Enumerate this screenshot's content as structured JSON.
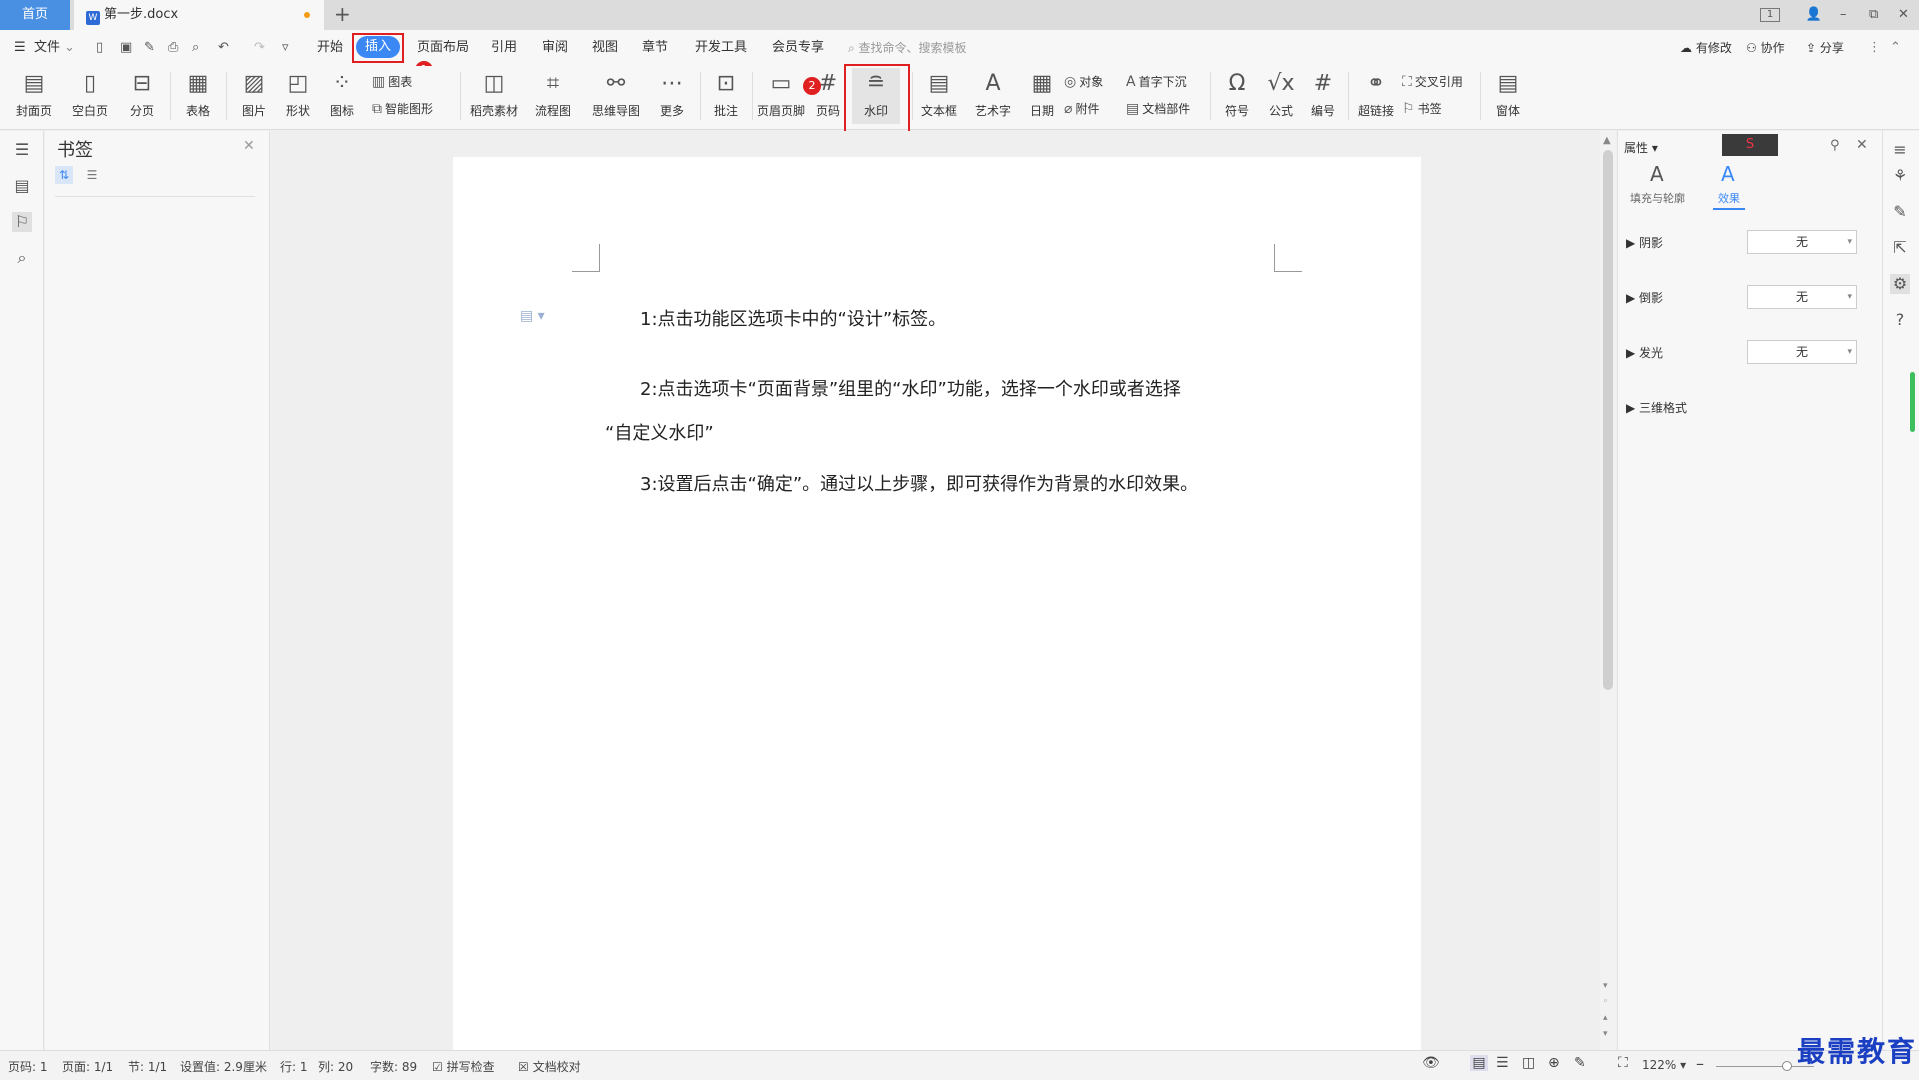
{
  "tabs": {
    "home": "首页",
    "doc": "第一步.docx",
    "doc_icon": "W",
    "new_tab": "+"
  },
  "window": {
    "count": "1",
    "minimize": "–",
    "restore": "⧉",
    "close": "✕",
    "avatar": "👤"
  },
  "menu": {
    "file": "文件",
    "items": [
      "开始",
      "插入",
      "页面布局",
      "引用",
      "审阅",
      "视图",
      "章节",
      "开发工具",
      "会员专享"
    ],
    "search": "查找命令、搜索模板",
    "changes": "有修改",
    "collab": "协作",
    "share": "分享"
  },
  "annotations": {
    "one": "1",
    "two": "2"
  },
  "toolbar": {
    "cover": "封面页",
    "blank": "空白页",
    "pagebreak": "分页",
    "table": "表格",
    "picture": "图片",
    "shape": "形状",
    "icon": "图标",
    "chart": "图表",
    "smartart": "智能图形",
    "material": "稻壳素材",
    "flowchart": "流程图",
    "mindmap": "思维导图",
    "more": "更多",
    "comment": "批注",
    "headerfooter": "页眉页脚",
    "pagenum": "页码",
    "watermark": "水印",
    "textbox": "文本框",
    "wordart": "艺术字",
    "date": "日期",
    "object": "对象",
    "attach": "附件",
    "dropcap": "首字下沉",
    "docpart": "文档部件",
    "symbol": "符号",
    "formula": "公式",
    "numbering": "编号",
    "hyperlink": "超链接",
    "crossref": "交叉引用",
    "bookmark": "书签",
    "window": "窗体"
  },
  "bookmark_panel": {
    "title": "书签"
  },
  "document": {
    "p1": "1:点击功能区选项卡中的“设计”标签。",
    "p2a": "2:点击选项卡“页面背景”组里的“水印”功能，选择一个水印或者选择",
    "p2b": "“自定义水印”",
    "p3": "3:设置后点击“确定”。通过以上步骤，即可获得作为背景的水印效果。"
  },
  "props": {
    "title": "属性",
    "tab_fill": "填充与轮廓",
    "tab_effect": "效果",
    "shadow": "阴影",
    "reflection": "倒影",
    "glow": "发光",
    "three_d": "三维格式",
    "none": "无"
  },
  "status": {
    "page": "页码: 1",
    "pages": "页面: 1/1",
    "section": "节: 1/1",
    "setting": "设置值: 2.9厘米",
    "row": "行: 1",
    "col": "列: 20",
    "words": "字数: 89",
    "spell": "拼写检查",
    "proof": "文档校对",
    "zoom": "122%"
  },
  "brand": {
    "logo": "最需教育"
  },
  "colors": {
    "accent": "#3b88f5",
    "annotation": "#e02020"
  }
}
